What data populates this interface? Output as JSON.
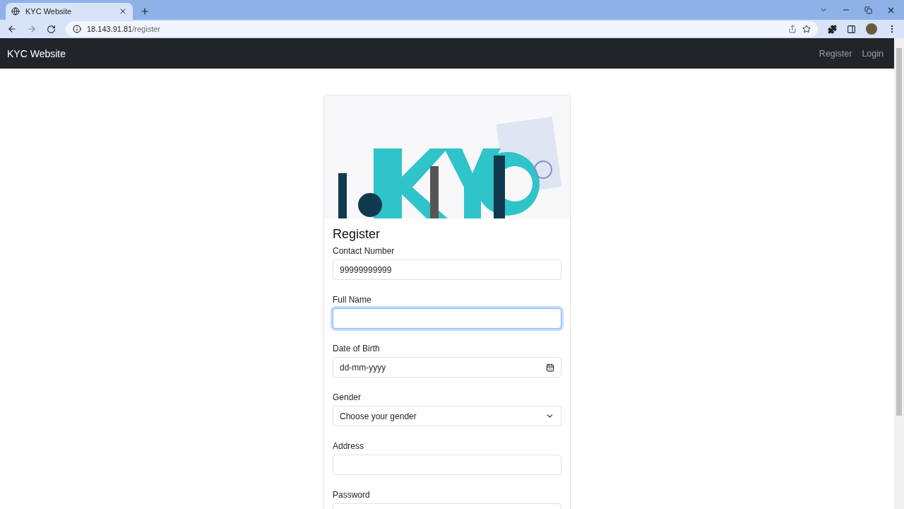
{
  "browser": {
    "tab": {
      "title": "KYC Website"
    },
    "address": {
      "host": "18.143.91.81",
      "path": "/register"
    }
  },
  "navbar": {
    "brand": "KYC Website",
    "links": [
      {
        "label": "Register"
      },
      {
        "label": "Login"
      }
    ]
  },
  "form": {
    "title": "Register",
    "fields": [
      {
        "label": "Contact Number",
        "kind": "text",
        "value": "99999999999",
        "focused": false
      },
      {
        "label": "Full Name",
        "kind": "text",
        "focused": true
      },
      {
        "label": "Date of Birth",
        "kind": "date",
        "placeholder": "dd-mm-yyyy",
        "focused": false
      },
      {
        "label": "Gender",
        "kind": "select",
        "value": "Choose your gender",
        "focused": false
      },
      {
        "label": "Address",
        "kind": "text",
        "focused": false
      },
      {
        "label": "Password",
        "kind": "text",
        "focused": false
      }
    ]
  }
}
